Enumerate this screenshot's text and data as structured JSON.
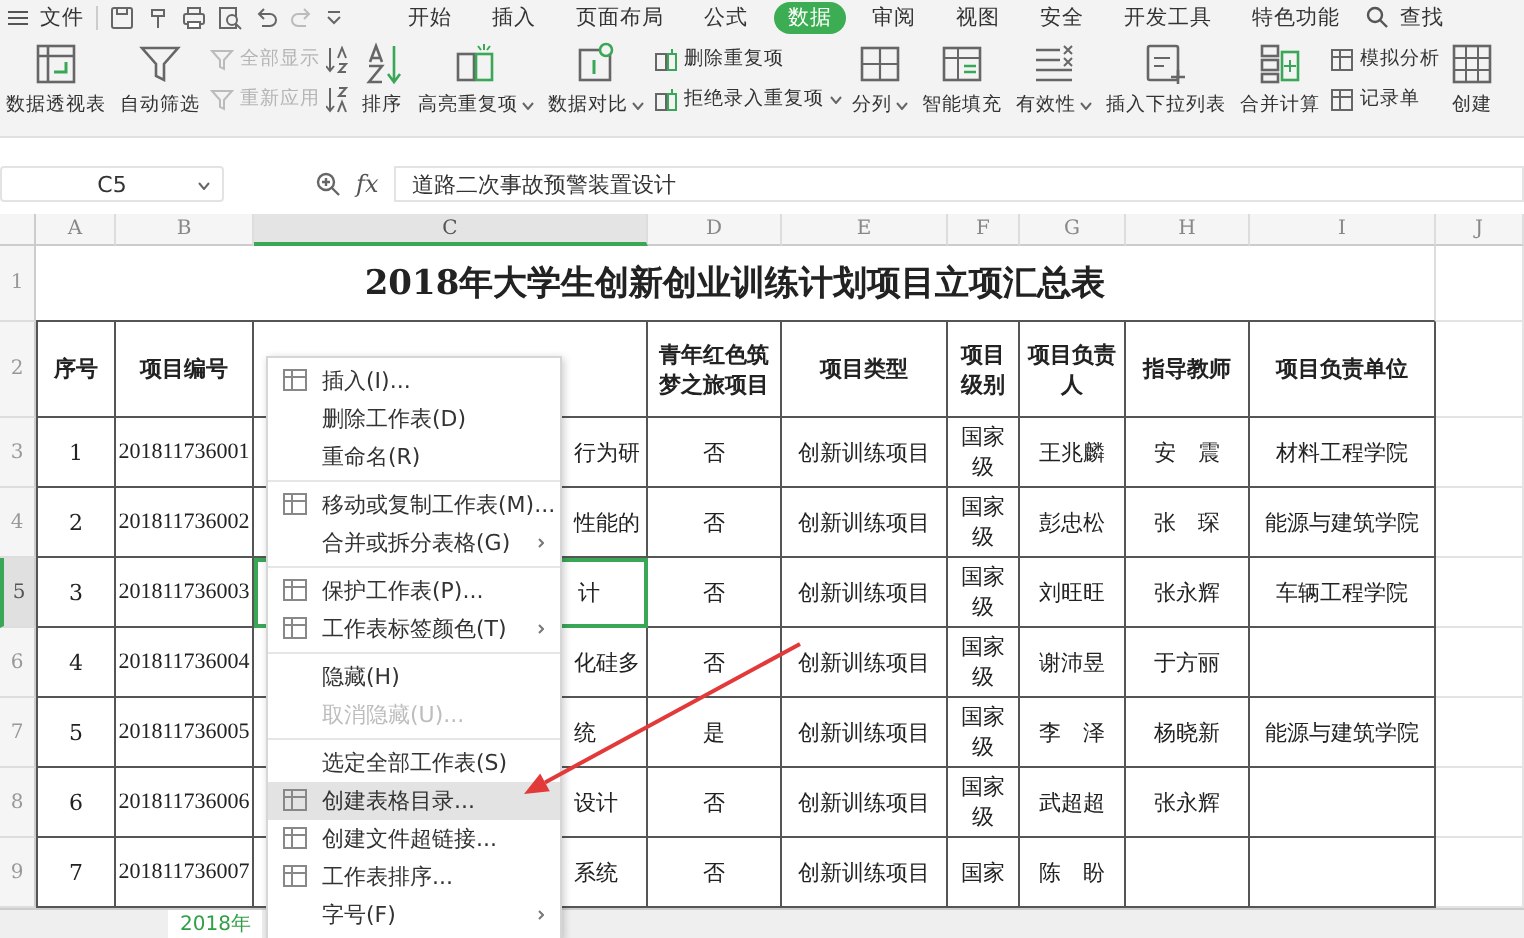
{
  "menu_bar": {
    "file_label": "文件",
    "tabs": [
      {
        "label": "开始",
        "selected": false
      },
      {
        "label": "插入",
        "selected": false
      },
      {
        "label": "页面布局",
        "selected": false
      },
      {
        "label": "公式",
        "selected": false
      },
      {
        "label": "数据",
        "selected": true
      },
      {
        "label": "审阅",
        "selected": false
      },
      {
        "label": "视图",
        "selected": false
      },
      {
        "label": "安全",
        "selected": false
      },
      {
        "label": "开发工具",
        "selected": false
      },
      {
        "label": "特色功能",
        "selected": false
      }
    ],
    "search_label": "查找"
  },
  "ribbon": {
    "groups": [
      {
        "kind": "large",
        "label": "数据透视表",
        "dropdown": false
      },
      {
        "kind": "large",
        "label": "自动筛选",
        "dropdown": false
      },
      {
        "kind": "stack",
        "items": [
          {
            "label": "全部显示",
            "disabled": true,
            "dropdown": false
          },
          {
            "label": "重新应用",
            "disabled": true,
            "dropdown": false
          }
        ]
      },
      {
        "kind": "sort",
        "label": "排序",
        "dropdown": false
      },
      {
        "kind": "large",
        "label": "高亮重复项",
        "dropdown": true
      },
      {
        "kind": "large",
        "label": "数据对比",
        "dropdown": true
      },
      {
        "kind": "stack",
        "items": [
          {
            "label": "删除重复项",
            "disabled": false,
            "dropdown": false
          },
          {
            "label": "拒绝录入重复项",
            "disabled": false,
            "dropdown": true
          }
        ]
      },
      {
        "kind": "large",
        "label": "分列",
        "dropdown": true
      },
      {
        "kind": "large",
        "label": "智能填充",
        "dropdown": false
      },
      {
        "kind": "large",
        "label": "有效性",
        "dropdown": true
      },
      {
        "kind": "large",
        "label": "插入下拉列表",
        "dropdown": false
      },
      {
        "kind": "large",
        "label": "合并计算",
        "dropdown": false
      },
      {
        "kind": "stack",
        "items": [
          {
            "label": "模拟分析",
            "disabled": false,
            "dropdown": false
          },
          {
            "label": "记录单",
            "disabled": false,
            "dropdown": false
          }
        ]
      },
      {
        "kind": "large",
        "label": "创建",
        "dropdown": false
      }
    ]
  },
  "formula_bar": {
    "cell_ref": "C5",
    "fx_label": "fx",
    "formula": "道路二次事故预警装置设计"
  },
  "sheet": {
    "columns": [
      {
        "label": "A",
        "selected": false
      },
      {
        "label": "B",
        "selected": false
      },
      {
        "label": "C",
        "selected": true
      },
      {
        "label": "D",
        "selected": false
      },
      {
        "label": "E",
        "selected": false
      },
      {
        "label": "F",
        "selected": false
      },
      {
        "label": "G",
        "selected": false
      },
      {
        "label": "H",
        "selected": false
      },
      {
        "label": "I",
        "selected": false
      },
      {
        "label": "J",
        "selected": false
      }
    ],
    "rows": [
      {
        "label": "1",
        "selected": false
      },
      {
        "label": "2",
        "selected": false
      },
      {
        "label": "3",
        "selected": false
      },
      {
        "label": "4",
        "selected": false
      },
      {
        "label": "5",
        "selected": true
      },
      {
        "label": "6",
        "selected": false
      },
      {
        "label": "7",
        "selected": false
      },
      {
        "label": "8",
        "selected": false
      },
      {
        "label": "9",
        "selected": false
      }
    ],
    "title": "2018年大学生创新创业训练计划项目立项汇总表",
    "header": {
      "A": "序号",
      "B": "项目编号",
      "D": "青年红色筑梦之旅项目",
      "E": "项目类型",
      "F": "项目级别",
      "G": "项目负责人",
      "H": "指导教师",
      "I": "项目负责单位"
    },
    "data": [
      {
        "A": "1",
        "B": "201811736001",
        "C": "行为研",
        "D": "否",
        "E": "创新训练项目",
        "F": "国家级",
        "G": "王兆麟",
        "H": "安　震",
        "I": "材料工程学院"
      },
      {
        "A": "2",
        "B": "201811736002",
        "C": "性能的",
        "D": "否",
        "E": "创新训练项目",
        "F": "国家级",
        "G": "彭忠松",
        "H": "张　琛",
        "I": "能源与建筑学院"
      },
      {
        "A": "3",
        "B": "201811736003",
        "C": "计",
        "D": "否",
        "E": "创新训练项目",
        "F": "国家级",
        "G": "刘旺旺",
        "H": "张永辉",
        "I": "车辆工程学院"
      },
      {
        "A": "4",
        "B": "201811736004",
        "C": "化硅多",
        "D": "否",
        "E": "创新训练项目",
        "F": "国家级",
        "G": "谢沛昱",
        "H": "于方丽"
      },
      {
        "A": "5",
        "B": "201811736005",
        "C": "统",
        "D": "是",
        "E": "创新训练项目",
        "F": "国家级",
        "G": "李　泽",
        "H": "杨晓新",
        "I": "能源与建筑学院"
      },
      {
        "A": "6",
        "B": "201811736006",
        "C": "设计",
        "D": "否",
        "E": "创新训练项目",
        "F": "国家级",
        "G": "武超超",
        "H": "张永辉"
      },
      {
        "A": "7",
        "B": "201811736007",
        "C": "系统",
        "D": "否",
        "E": "创新训练项目",
        "F": "国家",
        "G": "陈　盼"
      }
    ]
  },
  "context_menu": {
    "items": [
      {
        "kind": "item",
        "label": "插入(I)...",
        "has_icon": true,
        "has_submenu": false,
        "disabled": false,
        "selected": false
      },
      {
        "kind": "item",
        "label": "删除工作表(D)",
        "has_icon": false,
        "has_submenu": false,
        "disabled": false,
        "selected": false
      },
      {
        "kind": "item",
        "label": "重命名(R)",
        "has_icon": false,
        "has_submenu": false,
        "disabled": false,
        "selected": false
      },
      {
        "kind": "separator"
      },
      {
        "kind": "item",
        "label": "移动或复制工作表(M)...",
        "has_icon": true,
        "has_submenu": false,
        "disabled": false,
        "selected": false
      },
      {
        "kind": "item",
        "label": "合并或拆分表格(G)",
        "has_icon": false,
        "has_submenu": true,
        "disabled": false,
        "selected": false
      },
      {
        "kind": "separator"
      },
      {
        "kind": "item",
        "label": "保护工作表(P)...",
        "has_icon": true,
        "has_submenu": false,
        "disabled": false,
        "selected": false
      },
      {
        "kind": "item",
        "label": "工作表标签颜色(T)",
        "has_icon": true,
        "has_submenu": true,
        "disabled": false,
        "selected": false
      },
      {
        "kind": "separator"
      },
      {
        "kind": "item",
        "label": "隐藏(H)",
        "has_icon": false,
        "has_submenu": false,
        "disabled": false,
        "selected": false
      },
      {
        "kind": "item",
        "label": "取消隐藏(U)...",
        "has_icon": false,
        "has_submenu": false,
        "disabled": true,
        "selected": false
      },
      {
        "kind": "separator"
      },
      {
        "kind": "item",
        "label": "选定全部工作表(S)",
        "has_icon": false,
        "has_submenu": false,
        "disabled": false,
        "selected": false
      },
      {
        "kind": "item",
        "label": "创建表格目录...",
        "has_icon": true,
        "has_submenu": false,
        "disabled": false,
        "selected": true
      },
      {
        "kind": "item",
        "label": "创建文件超链接...",
        "has_icon": true,
        "has_submenu": false,
        "disabled": false,
        "selected": false
      },
      {
        "kind": "item",
        "label": "工作表排序...",
        "has_icon": true,
        "has_submenu": false,
        "disabled": false,
        "selected": false
      },
      {
        "kind": "item",
        "label": "字号(F)",
        "has_icon": false,
        "has_submenu": true,
        "disabled": false,
        "selected": false
      }
    ]
  },
  "sheet_tabs": [
    {
      "label": "2018年",
      "selected": true
    }
  ]
}
